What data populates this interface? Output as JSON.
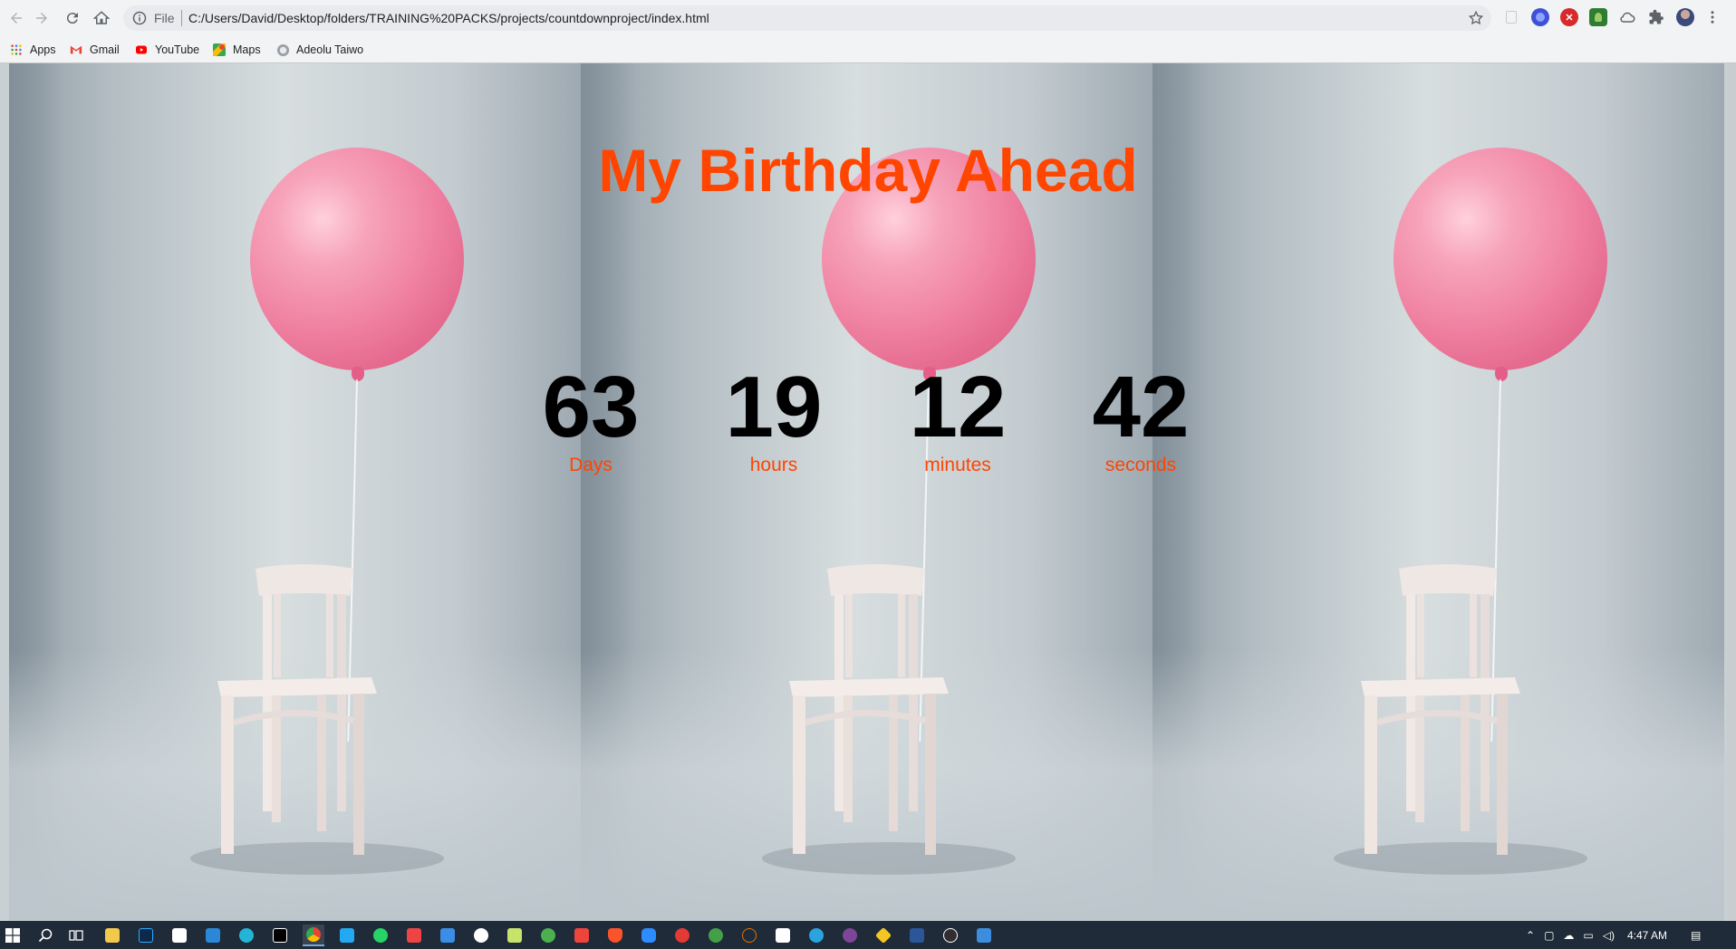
{
  "browser": {
    "omnibox": {
      "scheme_label": "File",
      "url": "C:/Users/David/Desktop/folders/TRAINING%20PACKS/projects/countdownproject/index.html"
    },
    "bookmarks": [
      {
        "label": "Apps",
        "icon": "apps-grid-icon"
      },
      {
        "label": "Gmail",
        "icon": "gmail-icon"
      },
      {
        "label": "YouTube",
        "icon": "youtube-icon"
      },
      {
        "label": "Maps",
        "icon": "maps-icon"
      },
      {
        "label": "Adeolu Taiwo",
        "icon": "globe-icon"
      }
    ]
  },
  "page": {
    "title": "My Birthday Ahead",
    "countdown": [
      {
        "value": "63",
        "label": "Days"
      },
      {
        "value": "19",
        "label": "hours"
      },
      {
        "value": "12",
        "label": "minutes"
      },
      {
        "value": "42",
        "label": "seconds"
      }
    ],
    "colors": {
      "accent": "#ff4500",
      "numbers": "#000000"
    }
  },
  "taskbar": {
    "clock": "4:47 AM"
  }
}
